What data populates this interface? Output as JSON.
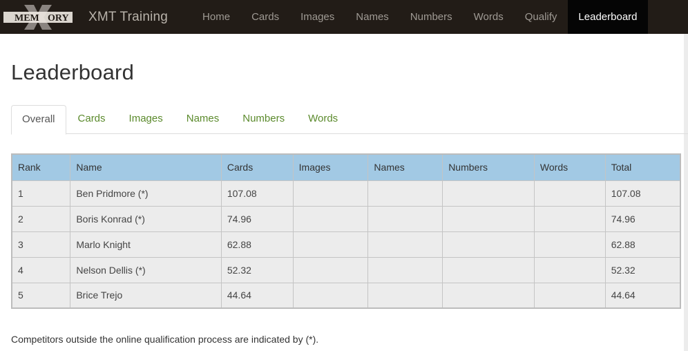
{
  "navbar": {
    "logo_text_left": "MEM",
    "logo_text_right": "ORY",
    "brand": "XMT Training",
    "items": [
      {
        "label": "Home",
        "active": false
      },
      {
        "label": "Cards",
        "active": false
      },
      {
        "label": "Images",
        "active": false
      },
      {
        "label": "Names",
        "active": false
      },
      {
        "label": "Numbers",
        "active": false
      },
      {
        "label": "Words",
        "active": false
      },
      {
        "label": "Qualify",
        "active": false
      },
      {
        "label": "Leaderboard",
        "active": true
      }
    ]
  },
  "page": {
    "title": "Leaderboard"
  },
  "tabs": [
    {
      "label": "Overall",
      "active": true
    },
    {
      "label": "Cards",
      "active": false
    },
    {
      "label": "Images",
      "active": false
    },
    {
      "label": "Names",
      "active": false
    },
    {
      "label": "Numbers",
      "active": false
    },
    {
      "label": "Words",
      "active": false
    }
  ],
  "table": {
    "columns": [
      "Rank",
      "Name",
      "Cards",
      "Images",
      "Names",
      "Numbers",
      "Words",
      "Total"
    ],
    "rows": [
      [
        "1",
        "Ben Pridmore (*)",
        "107.08",
        "",
        "",
        "",
        "",
        "107.08"
      ],
      [
        "2",
        "Boris Konrad (*)",
        "74.96",
        "",
        "",
        "",
        "",
        "74.96"
      ],
      [
        "3",
        "Marlo Knight",
        "62.88",
        "",
        "",
        "",
        "",
        "62.88"
      ],
      [
        "4",
        "Nelson Dellis (*)",
        "52.32",
        "",
        "",
        "",
        "",
        "52.32"
      ],
      [
        "5",
        "Brice Trejo",
        "44.64",
        "",
        "",
        "",
        "",
        "44.64"
      ]
    ]
  },
  "footnote": "Competitors outside the online qualification process are indicated by (*).",
  "colors": {
    "navbar_bg": "#221c17",
    "nav_active_bg": "#050505",
    "tab_link": "#5b8a2c",
    "table_header_bg": "#a2c9e4",
    "table_row_bg": "#ececec"
  }
}
